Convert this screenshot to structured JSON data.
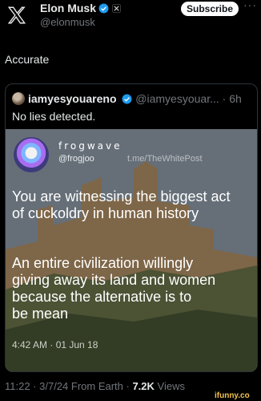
{
  "post": {
    "author_name": "Elon Musk",
    "author_handle": "@elonmusk",
    "subscribe_label": "Subscribe",
    "more_label": "···",
    "text": "Accurate",
    "timestamp": "11:22 · 3/7/24 From Earth · ",
    "views_count": "7.2K",
    "views_label": " Views"
  },
  "quote": {
    "author_name": "iamyesyouareno",
    "author_handle": "@iamyesyouar...",
    "time": "· 6h",
    "text": "No lies detected."
  },
  "media": {
    "name": "frogwave",
    "handle": "@frogjoo",
    "watermark": "t.me/TheWhitePost",
    "line1": "You are witnessing the biggest act",
    "line2": "of cuckoldry in human history",
    "line3": "An entire civilization willingly",
    "line4": "giving away its land and women",
    "line5": "because the alternative is to",
    "line6": "be mean",
    "time": "4:42 AM · 01 Jun 18"
  },
  "watermark_site": "ifunny.co",
  "colors": {
    "verified": "#1d9bf0",
    "background": "#000000",
    "muted": "#71767b"
  }
}
